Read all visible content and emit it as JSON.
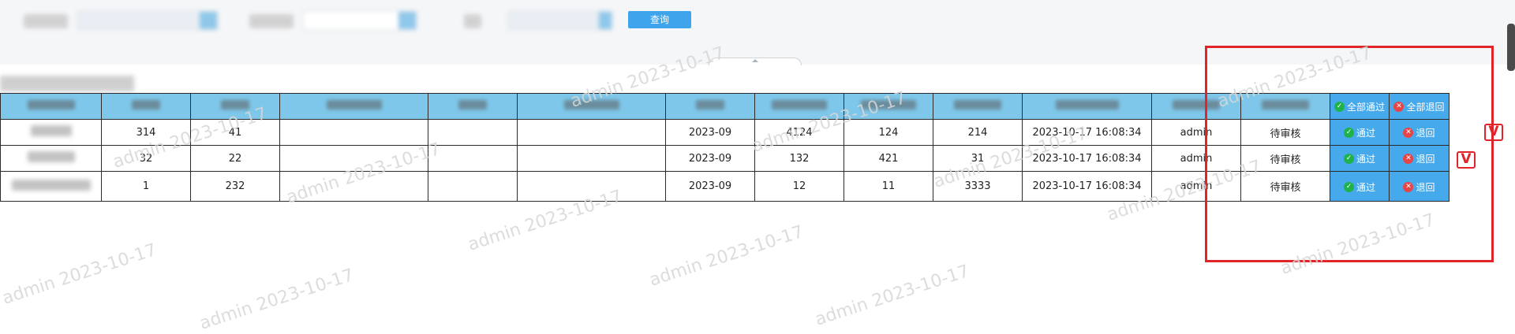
{
  "filters": {
    "query_button": "查询"
  },
  "table": {
    "columns": [
      "",
      "",
      "",
      "",
      "",
      "",
      "",
      "",
      "",
      "",
      "",
      "",
      "",
      "",
      "",
      ""
    ],
    "header_actions": {
      "approve_all": "全部通过",
      "reject_all": "全部退回"
    },
    "rows": [
      {
        "c1": "314",
        "c2": "41",
        "period": "2023-09",
        "v1": "4124",
        "v2": "124",
        "v3": "214",
        "time": "2023-10-17 16:08:34",
        "user": "admin",
        "status": "待审核",
        "approve": "通过",
        "reject": "退回"
      },
      {
        "c1": "32",
        "c2": "22",
        "period": "2023-09",
        "v1": "132",
        "v2": "421",
        "v3": "31",
        "time": "2023-10-17 16:08:34",
        "user": "admin",
        "status": "待审核",
        "approve": "通过",
        "reject": "退回"
      },
      {
        "c1": "1",
        "c2": "232",
        "period": "2023-09",
        "v1": "12",
        "v2": "11",
        "v3": "3333",
        "time": "2023-10-17 16:08:34",
        "user": "admin",
        "status": "待审核",
        "approve": "通过",
        "reject": "退回"
      }
    ]
  },
  "watermark": "admin  2023-10-17",
  "annotation": {
    "marks": [
      "V",
      "V"
    ]
  },
  "colors": {
    "header_bg": "#7ec7ea",
    "action_bg": "#46a9ec",
    "query_button": "#3ea4ec",
    "annotation": "#e0242a"
  }
}
